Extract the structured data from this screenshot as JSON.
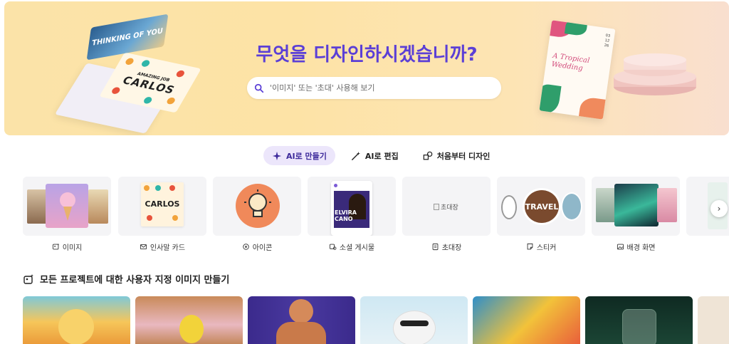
{
  "hero": {
    "title": "무엇을 디자인하시겠습니까?",
    "search_placeholder": "'이미지' 또는 '초대' 사용해 보기",
    "card1_text": "THINKING OF YOU",
    "card2_small": "AMAZING JOB",
    "card2_big": "CARLOS",
    "wedding_title": "A Tropical Wedding",
    "wedding_date": "03\n12\n26"
  },
  "tabs": [
    {
      "label": "AI로 만들기",
      "icon": "sparkle-icon",
      "active": true
    },
    {
      "label": "AI로 편집",
      "icon": "magic-wand-icon",
      "active": false
    },
    {
      "label": "처음부터 디자인",
      "icon": "shapes-icon",
      "active": false
    }
  ],
  "categories": [
    {
      "label": "이미지",
      "icon": "image-sparkle-icon"
    },
    {
      "label": "인사말 카드",
      "icon": "mail-icon"
    },
    {
      "label": "아이콘",
      "icon": "icon-shapes-icon"
    },
    {
      "label": "소셜 게시물",
      "icon": "social-icon"
    },
    {
      "label": "초대장",
      "icon": "invitation-icon",
      "broken_image_text": "초대장"
    },
    {
      "label": "스티커",
      "icon": "sticker-icon"
    },
    {
      "label": "배경 화면",
      "icon": "wallpaper-icon"
    }
  ],
  "category_thumbs": {
    "card_big": "CARLOS",
    "social_name": "ELVIRA\nCANO",
    "sticker_text": "TRAVEL"
  },
  "section": {
    "title": "모든 프로젝트에 대한 사용자 지정 이미지 만들기",
    "icon": "image-sparkle-icon"
  },
  "colors": {
    "accent": "#5b3fd6",
    "tab_active_bg": "#ece6fb"
  }
}
